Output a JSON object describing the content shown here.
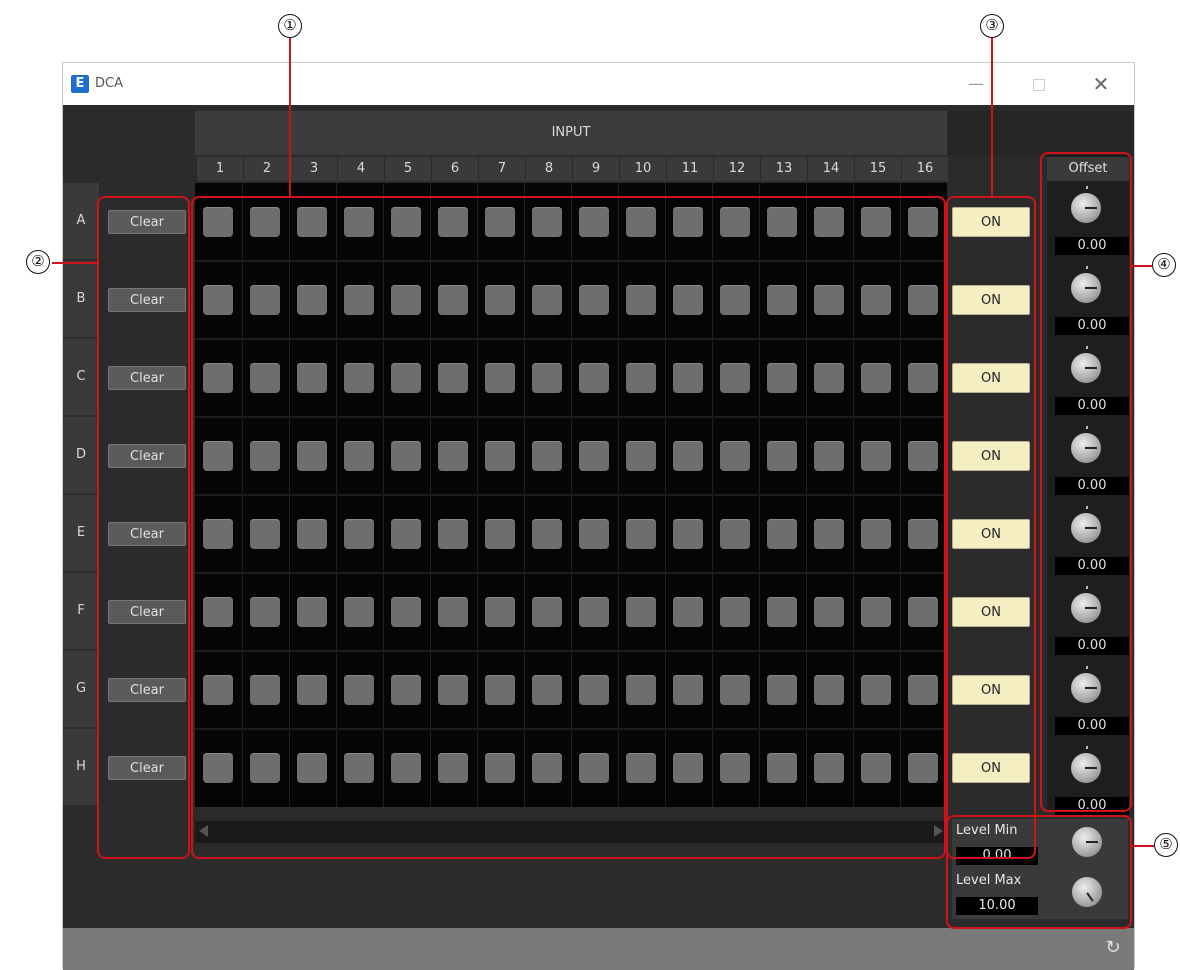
{
  "window": {
    "title": "DCA",
    "logo_letter": "E",
    "minimize": "—",
    "close": "✕"
  },
  "matrix": {
    "header": "INPUT",
    "columns": [
      "1",
      "2",
      "3",
      "4",
      "5",
      "6",
      "7",
      "8",
      "9",
      "10",
      "11",
      "12",
      "13",
      "14",
      "15",
      "16"
    ],
    "rows": [
      {
        "label": "A",
        "clear": "Clear",
        "on": "ON",
        "offset": "0.00"
      },
      {
        "label": "B",
        "clear": "Clear",
        "on": "ON",
        "offset": "0.00"
      },
      {
        "label": "C",
        "clear": "Clear",
        "on": "ON",
        "offset": "0.00"
      },
      {
        "label": "D",
        "clear": "Clear",
        "on": "ON",
        "offset": "0.00"
      },
      {
        "label": "E",
        "clear": "Clear",
        "on": "ON",
        "offset": "0.00"
      },
      {
        "label": "F",
        "clear": "Clear",
        "on": "ON",
        "offset": "0.00"
      },
      {
        "label": "G",
        "clear": "Clear",
        "on": "ON",
        "offset": "0.00"
      },
      {
        "label": "H",
        "clear": "Clear",
        "on": "ON",
        "offset": "0.00"
      }
    ]
  },
  "offset": {
    "title": "Offset"
  },
  "level": {
    "min_label": "Level Min",
    "min_value": "0.00",
    "max_label": "Level Max",
    "max_value": "10.00"
  },
  "callouts": [
    "①",
    "②",
    "③",
    "④",
    "⑤"
  ],
  "colors": {
    "annotation": "#d0121b",
    "on_button": "#f5eec3",
    "cell": "#6e6e6e"
  },
  "icons": {
    "refresh": "refresh-icon"
  }
}
